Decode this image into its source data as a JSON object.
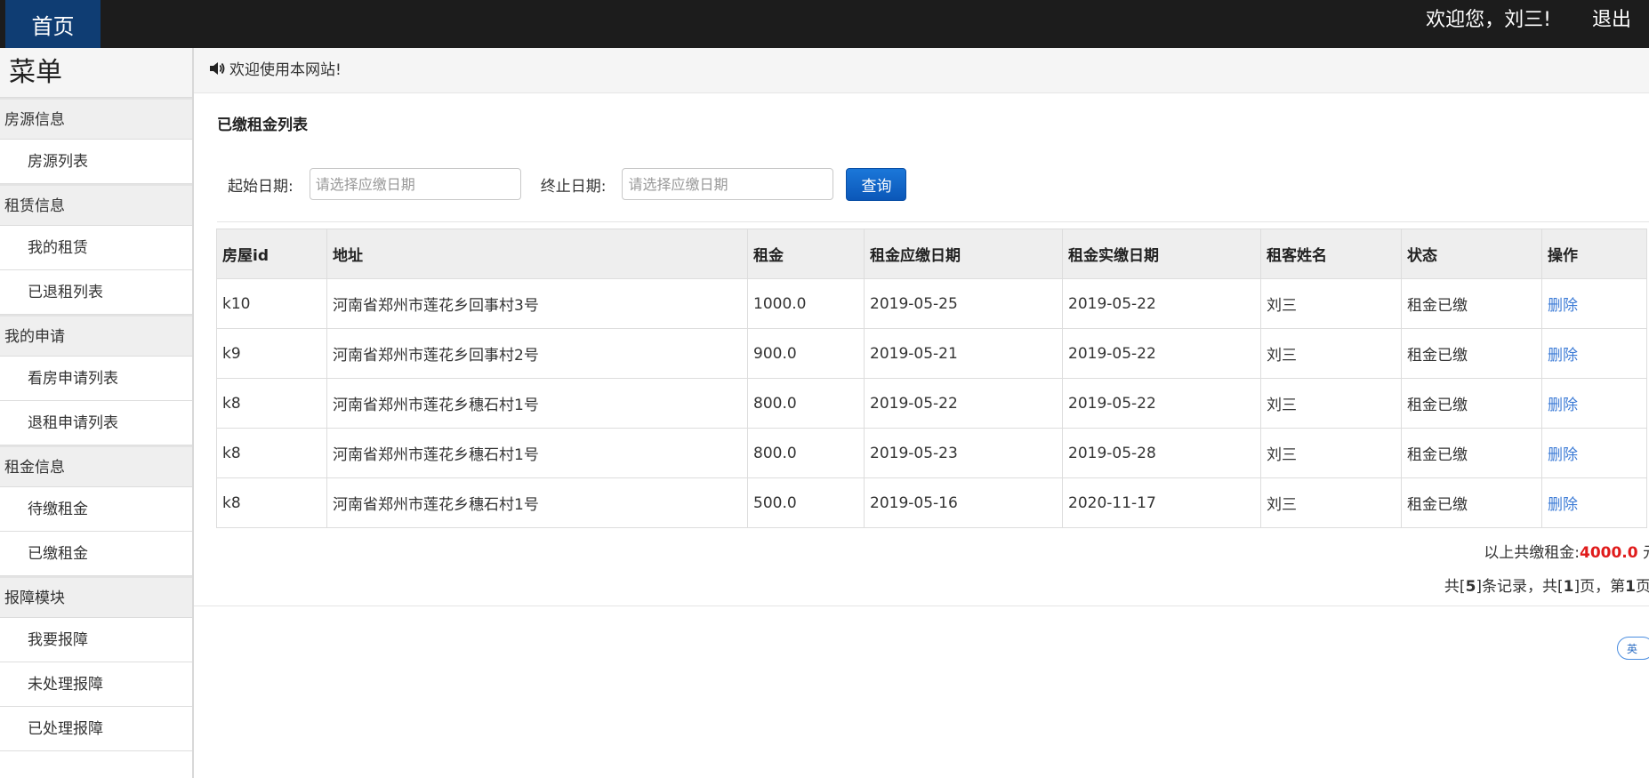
{
  "topbar": {
    "home_label": "首页",
    "welcome_text": "欢迎您，刘三!",
    "logout_label": "退出"
  },
  "sidebar": {
    "title": "菜单",
    "groups": [
      {
        "label": "房源信息",
        "items": [
          "房源列表"
        ]
      },
      {
        "label": "租赁信息",
        "items": [
          "我的租赁",
          "已退租列表"
        ]
      },
      {
        "label": "我的申请",
        "items": [
          "看房申请列表",
          "退租申请列表"
        ]
      },
      {
        "label": "租金信息",
        "items": [
          "待缴租金",
          "已缴租金"
        ]
      },
      {
        "label": "报障模块",
        "items": [
          "我要报障",
          "未处理报障",
          "已处理报障"
        ]
      }
    ]
  },
  "notice": {
    "text": "欢迎使用本网站!"
  },
  "main": {
    "section_title": "已缴租金列表",
    "filter": {
      "start_label": "起始日期:",
      "start_placeholder": "请选择应缴日期",
      "end_label": "终止日期:",
      "end_placeholder": "请选择应缴日期",
      "query_label": "查询"
    },
    "table": {
      "headers": [
        "房屋id",
        "地址",
        "租金",
        "租金应缴日期",
        "租金实缴日期",
        "租客姓名",
        "状态",
        "操作"
      ],
      "rows": [
        [
          "k10",
          "河南省郑州市莲花乡回事村3号",
          "1000.0",
          "2019-05-25",
          "2019-05-22",
          "刘三",
          "租金已缴",
          "删除"
        ],
        [
          "k9",
          "河南省郑州市莲花乡回事村2号",
          "900.0",
          "2019-05-21",
          "2019-05-22",
          "刘三",
          "租金已缴",
          "删除"
        ],
        [
          "k8",
          "河南省郑州市莲花乡穗石村1号",
          "800.0",
          "2019-05-22",
          "2019-05-22",
          "刘三",
          "租金已缴",
          "删除"
        ],
        [
          "k8",
          "河南省郑州市莲花乡穗石村1号",
          "800.0",
          "2019-05-23",
          "2019-05-28",
          "刘三",
          "租金已缴",
          "删除"
        ],
        [
          "k8",
          "河南省郑州市莲花乡穗石村1号",
          "500.0",
          "2019-05-16",
          "2020-11-17",
          "刘三",
          "租金已缴",
          "删除"
        ]
      ]
    },
    "total": {
      "prefix": "以上共缴租金:",
      "amount": "4000.0",
      "suffix": "元"
    },
    "pager": {
      "p1": "共[",
      "records": "5",
      "p2": "]条记录，共[",
      "pages": "1",
      "p3": "]页，第",
      "current": "1",
      "p4": "页"
    },
    "ime_badge": "英"
  }
}
